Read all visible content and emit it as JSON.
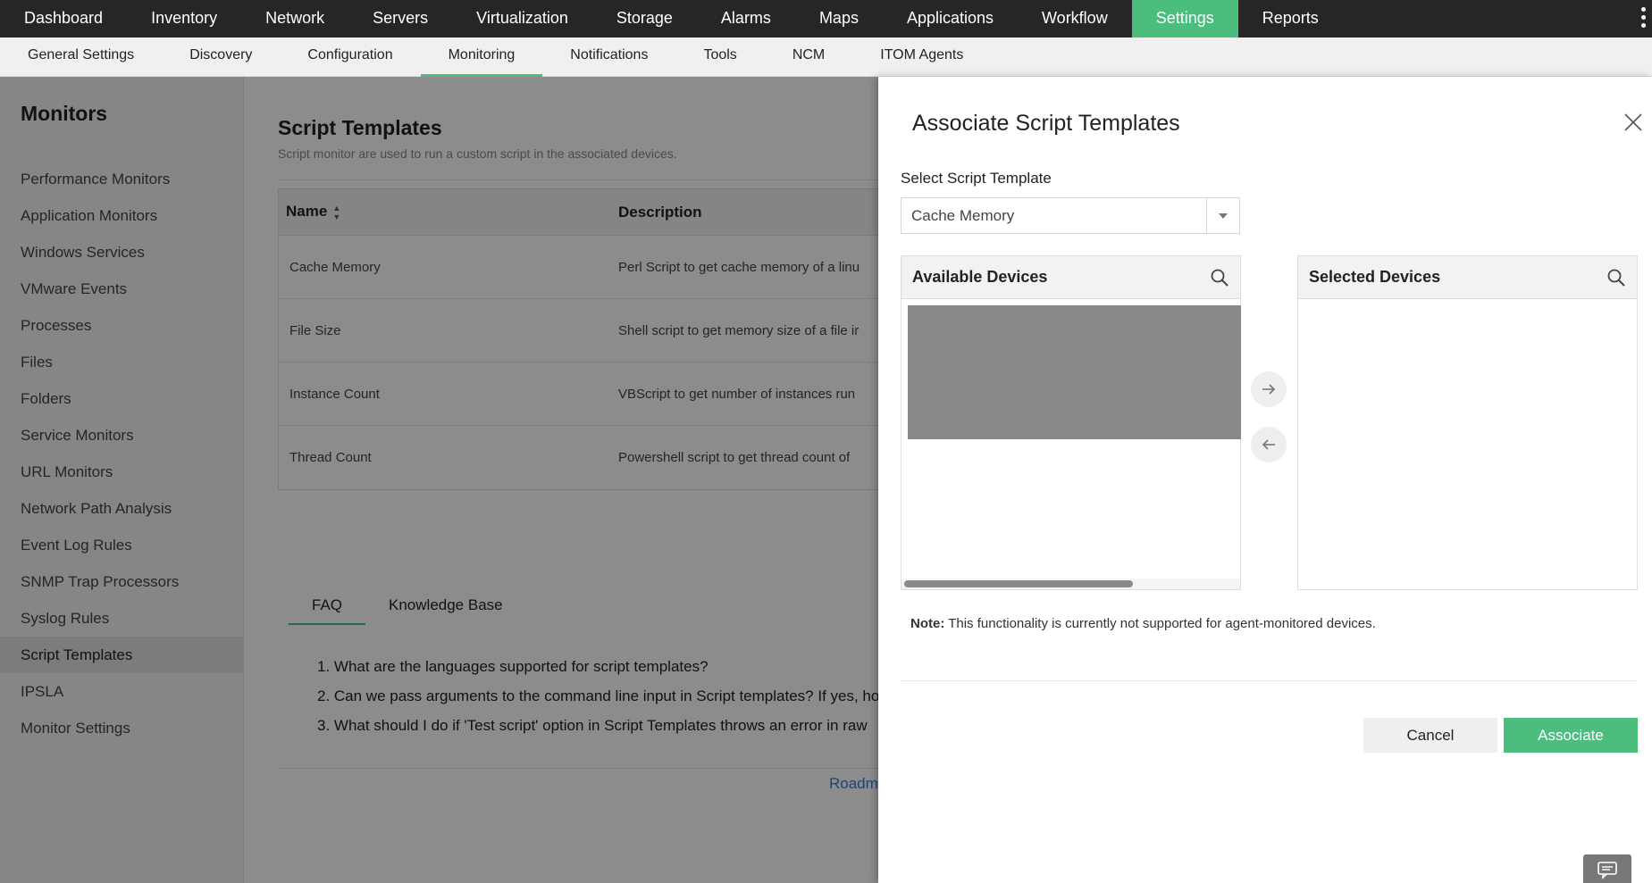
{
  "topnav": {
    "items": [
      "Dashboard",
      "Inventory",
      "Network",
      "Servers",
      "Virtualization",
      "Storage",
      "Alarms",
      "Maps",
      "Applications",
      "Workflow",
      "Settings",
      "Reports"
    ],
    "active": "Settings"
  },
  "subnav": {
    "items": [
      "General Settings",
      "Discovery",
      "Configuration",
      "Monitoring",
      "Notifications",
      "Tools",
      "NCM",
      "ITOM Agents"
    ],
    "active": "Monitoring"
  },
  "sidebar": {
    "title": "Monitors",
    "items": [
      "Performance Monitors",
      "Application Monitors",
      "Windows Services",
      "VMware Events",
      "Processes",
      "Files",
      "Folders",
      "Service Monitors",
      "URL Monitors",
      "Network Path Analysis",
      "Event Log Rules",
      "SNMP Trap Processors",
      "Syslog Rules",
      "Script Templates",
      "IPSLA",
      "Monitor Settings"
    ],
    "active": "Script Templates"
  },
  "main": {
    "title": "Script Templates",
    "subtitle": "Script monitor are used to run a custom script in the associated devices.",
    "table": {
      "headers": [
        "Name",
        "Description"
      ],
      "rows": [
        [
          "Cache Memory",
          "Perl Script to get cache memory of a linu"
        ],
        [
          "File Size",
          "Shell script to get memory size of a file ir"
        ],
        [
          "Instance Count",
          "VBScript to get number of instances run"
        ],
        [
          "Thread Count",
          "Powershell script to get thread count of"
        ]
      ]
    },
    "tabs": [
      "FAQ",
      "Knowledge Base"
    ],
    "faq": [
      "1. What are the languages supported for script templates?",
      "2. Can we pass arguments to the command line input in Script templates? If yes, hov",
      "3. What should I do if 'Test script' option in Script Templates throws an error in raw"
    ],
    "roadmap_link": "Roadm"
  },
  "modal": {
    "title": "Associate Script Templates",
    "select_label": "Select Script Template",
    "select_value": "Cache Memory",
    "available_header": "Available Devices",
    "selected_header": "Selected Devices",
    "note_label": "Note:",
    "note_text": " This functionality is currently not supported for agent-monitored devices.",
    "cancel_label": "Cancel",
    "associate_label": "Associate"
  },
  "colors": {
    "accent": "#4bbe7e",
    "topnav_bg": "#262626",
    "link": "#3a7bd5"
  },
  "icons": [
    "search-icon",
    "close-icon",
    "arrow-right-icon",
    "arrow-left-icon",
    "chevron-down-icon",
    "sort-icon",
    "chat-icon",
    "more-vertical-icon"
  ]
}
